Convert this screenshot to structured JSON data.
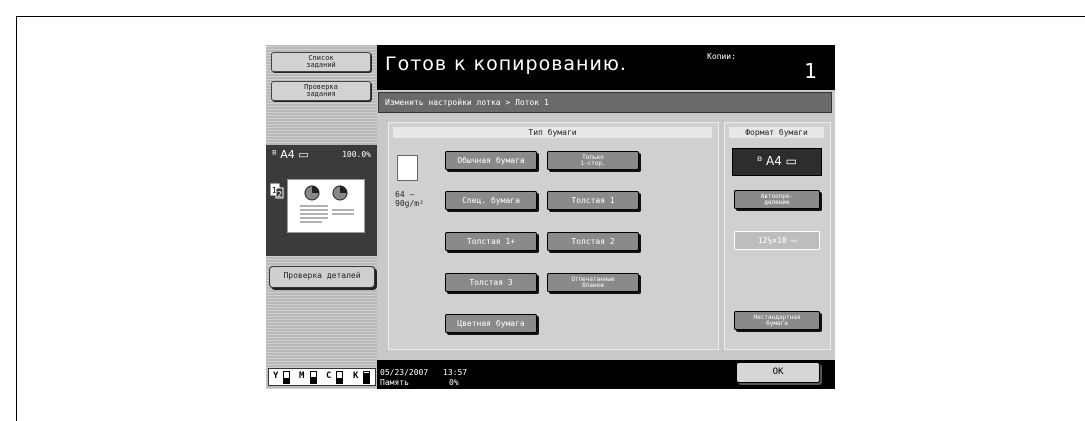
{
  "sidebar": {
    "job_list_label": "Список\nзаданий",
    "job_check_label": "Проверка\nзадания",
    "preview": {
      "paper": "ᴮ A4 ▭",
      "zoom": "100.0%"
    },
    "details_label": "Проверка деталей",
    "toner": [
      "Y",
      "M",
      "C",
      "K"
    ]
  },
  "header": {
    "title": "Готов к копированию.",
    "copies_label": "Копии:",
    "copies_value": "1"
  },
  "breadcrumb": "Изменить настройки лотка > Лоток 1",
  "paper_type": {
    "heading": "Тип бумаги",
    "weight": "64 –\n90g/m²",
    "buttons": {
      "plain": "Обычная бумага",
      "single_side": "Только\n1-стор.",
      "special": "Спец. бумага",
      "thick1": "Толстая 1",
      "thick1plus": "Толстая 1+",
      "thick2": "Толстая 2",
      "thick3": "Толстая 3",
      "letterhead": "Отпечатанные\nбланки",
      "color": "Цветная бумага"
    }
  },
  "paper_size": {
    "heading": "Формат бумаги",
    "selected": "ᴮ A4 ▭",
    "auto_detect": "Автоопре-\nделение",
    "inch_size": "12¼×18 ▭",
    "custom": "Нестандартная\nбумага"
  },
  "footer": {
    "date": "05/23/2007",
    "time": "13:57",
    "memory_label": "Память",
    "memory_value": "0%",
    "ok_label": "OK"
  }
}
